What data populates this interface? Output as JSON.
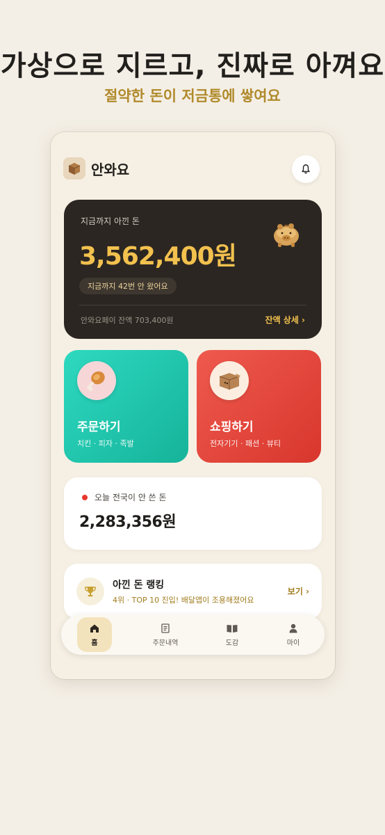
{
  "promo": {
    "headline": "가상으로 지르고, 진짜로 아껴요",
    "subline": "절약한 돈이 저금통에 쌓여요"
  },
  "app": {
    "name": "안와요"
  },
  "savings": {
    "label": "지금까지 아낀 돈",
    "amount": "3,562,400원",
    "count_pill": "지금까지 42번 안 왔어요",
    "balance": "안와요페이 잔액 703,400원",
    "balance_link": "잔액 상세 ›"
  },
  "actions": [
    {
      "title": "주문하기",
      "subtitle": "치킨 · 피자 · 족발",
      "icon": "chicken-drumstick-icon"
    },
    {
      "title": "쇼핑하기",
      "subtitle": "전자기기 · 패션 · 뷰티",
      "icon": "shopping-box-icon"
    }
  ],
  "national": {
    "label": "오늘 전국이 안 쓴 돈",
    "amount": "2,283,356원"
  },
  "ranking": {
    "title": "아낀 돈 랭킹",
    "subtitle": "4위 · TOP 10 진입! 배달앱이 조용해졌어요",
    "link": "보기 ›"
  },
  "nav": [
    {
      "label": "홈",
      "icon": "home-icon",
      "active": true
    },
    {
      "label": "주문내역",
      "icon": "receipt-icon",
      "active": false
    },
    {
      "label": "도감",
      "icon": "book-icon",
      "active": false
    },
    {
      "label": "마이",
      "icon": "person-icon",
      "active": false
    }
  ],
  "colors": {
    "background": "#f4efe6",
    "accent_gold": "#f2c14e",
    "order_teal": "#1fc7ad",
    "shop_red": "#e4453a",
    "dark_card": "#2b2622"
  }
}
